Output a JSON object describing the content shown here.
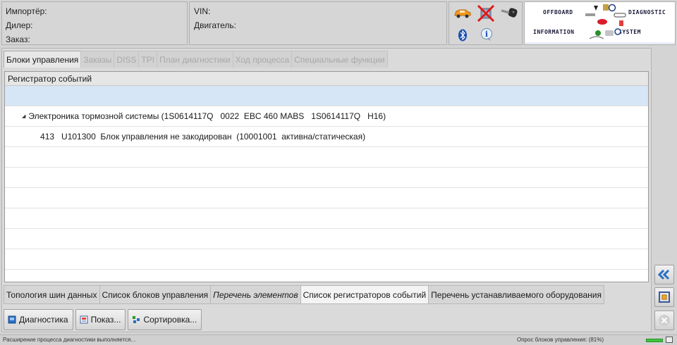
{
  "header": {
    "importer_label": "Импортёр:",
    "dealer_label": "Дилер:",
    "order_label": "Заказ:",
    "vin_label": "VIN:",
    "engine_label": "Двигатель:",
    "logo": {
      "offboard": "OFFBOARD",
      "diagnostic": "DIAGNOSTIC",
      "information": "INFORMATION",
      "system": "SYSTEM"
    }
  },
  "tabs_top": [
    {
      "label": "Блоки управления",
      "active": true
    },
    {
      "label": "Заказы",
      "active": false
    },
    {
      "label": "DISS",
      "active": false
    },
    {
      "label": "TPI",
      "active": false
    },
    {
      "label": "План диагностики",
      "active": false
    },
    {
      "label": "Ход процесса",
      "active": false
    },
    {
      "label": "Специальные функции",
      "active": false
    }
  ],
  "panel": {
    "title": "Регистратор событий",
    "group_row": "Электроника тормозной системы (1S0614117Q   0022  EBC 460 MABS   1S0614117Q   H16)",
    "child_row": "413   U101300  Блок управления не закодирован  (10001001  активна/статическая)"
  },
  "tabs_bottom": [
    {
      "label": "Топология шин данных"
    },
    {
      "label": "Список блоков управления"
    },
    {
      "label": "Перечень элементов"
    },
    {
      "label": "Список регистраторов событий"
    },
    {
      "label": "Перечень устанавливаемого оборудования"
    }
  ],
  "buttons": {
    "diagnostics": "Диагностика",
    "show": "Показ...",
    "sort": "Сортировка..."
  },
  "status": {
    "left": "Расширение процесса диагностики выполняется...",
    "right": "Опрос блоков управления: (81%)",
    "progress_percent": 81
  },
  "colors": {
    "selected_row": "#d7e6f6",
    "side_arrow": "#2a6fc4",
    "progress": "#3ec63e"
  }
}
